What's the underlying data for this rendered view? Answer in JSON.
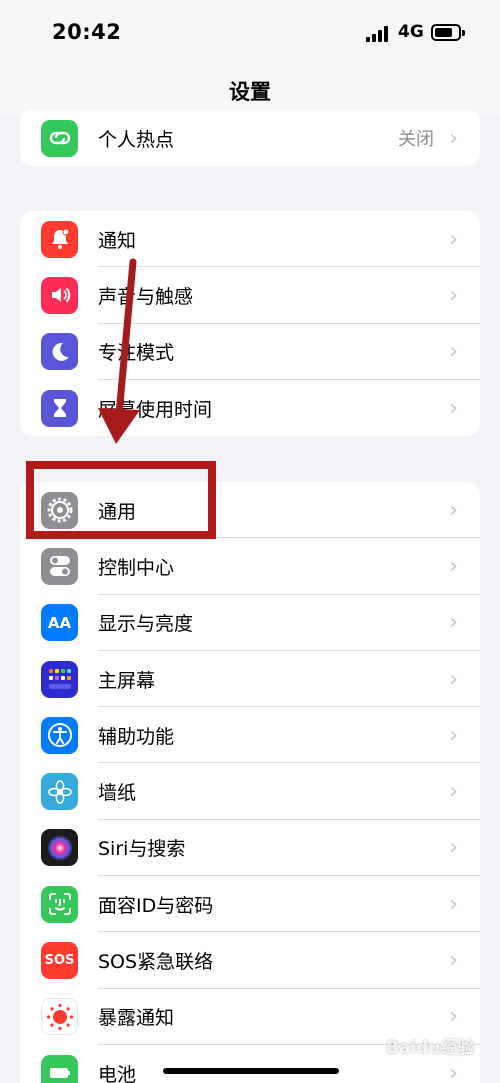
{
  "status": {
    "time": "20:42",
    "network": "4G"
  },
  "nav": {
    "title": "设置"
  },
  "group1": [
    {
      "label": "个人热点",
      "value": "关闭",
      "icon": "hotspot-icon",
      "color": "#34c759"
    }
  ],
  "group2": [
    {
      "label": "通知",
      "icon": "bell-icon",
      "color": "#ff3b30"
    },
    {
      "label": "声音与触感",
      "icon": "speaker-icon",
      "color": "#ff2d55"
    },
    {
      "label": "专注模式",
      "icon": "moon-icon",
      "color": "#5856d6"
    },
    {
      "label": "屏幕使用时间",
      "icon": "hourglass-icon",
      "color": "#5856d6"
    }
  ],
  "group3": [
    {
      "label": "通用",
      "icon": "gear-icon",
      "color": "#8e8e93"
    },
    {
      "label": "控制中心",
      "icon": "toggles-icon",
      "color": "#8e8e93"
    },
    {
      "label": "显示与亮度",
      "icon": "text-size-icon",
      "color": "#007aff",
      "glyph": "AA"
    },
    {
      "label": "主屏幕",
      "icon": "app-grid-icon",
      "color": "#2c2ccf"
    },
    {
      "label": "辅助功能",
      "icon": "accessibility-icon",
      "color": "#007aff"
    },
    {
      "label": "墙纸",
      "icon": "flower-icon",
      "color": "#36aadc"
    },
    {
      "label": "Siri与搜索",
      "icon": "siri-icon",
      "color": "#1c1c1e"
    },
    {
      "label": "面容ID与密码",
      "icon": "face-id-icon",
      "color": "#34c759"
    },
    {
      "label": "SOS紧急联络",
      "icon": "sos-icon",
      "color": "#ff3b30",
      "glyph": "SOS"
    },
    {
      "label": "暴露通知",
      "icon": "exposure-icon",
      "color": "#ffffff"
    },
    {
      "label": "电池",
      "icon": "battery-icon",
      "color": "#34c759"
    }
  ],
  "watermark": "Baidu经验"
}
